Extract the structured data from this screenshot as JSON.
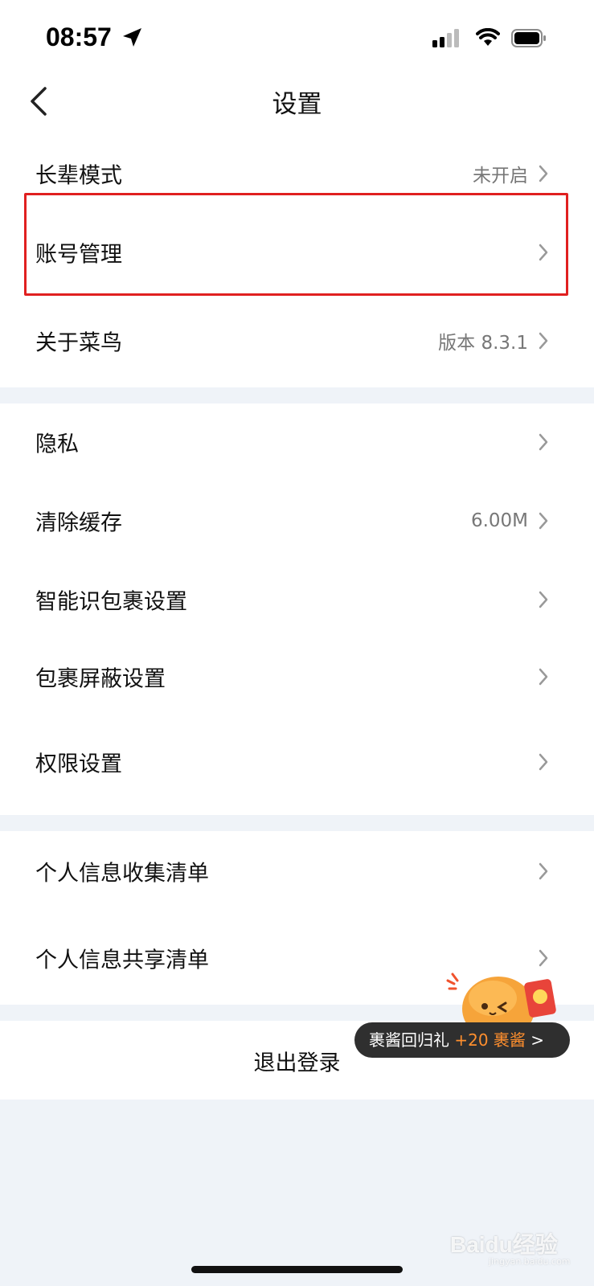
{
  "status_bar": {
    "time": "08:57"
  },
  "nav": {
    "title": "设置"
  },
  "groups": [
    {
      "rows": [
        {
          "label": "长辈模式",
          "value": "未开启"
        },
        {
          "label": "账号管理",
          "value": ""
        },
        {
          "label": "关于菜鸟",
          "value": "版本 8.3.1"
        }
      ]
    },
    {
      "rows": [
        {
          "label": "隐私",
          "value": ""
        },
        {
          "label": "清除缓存",
          "value": "6.00M"
        },
        {
          "label": "智能识包裹设置",
          "value": ""
        },
        {
          "label": "包裹屏蔽设置",
          "value": ""
        },
        {
          "label": "权限设置",
          "value": ""
        }
      ]
    },
    {
      "rows": [
        {
          "label": "个人信息收集清单",
          "value": ""
        },
        {
          "label": "个人信息共享清单",
          "value": ""
        }
      ]
    }
  ],
  "logout": {
    "label": "退出登录"
  },
  "promo": {
    "text": "裹酱回归礼",
    "reward": "+20 裹酱",
    "arrow": ">"
  },
  "watermark": {
    "brand": "Baidu经验",
    "url": "jingyan.baidu.com"
  },
  "colors": {
    "highlight": "#e02020",
    "promo_accent": "#ff8f2e"
  }
}
